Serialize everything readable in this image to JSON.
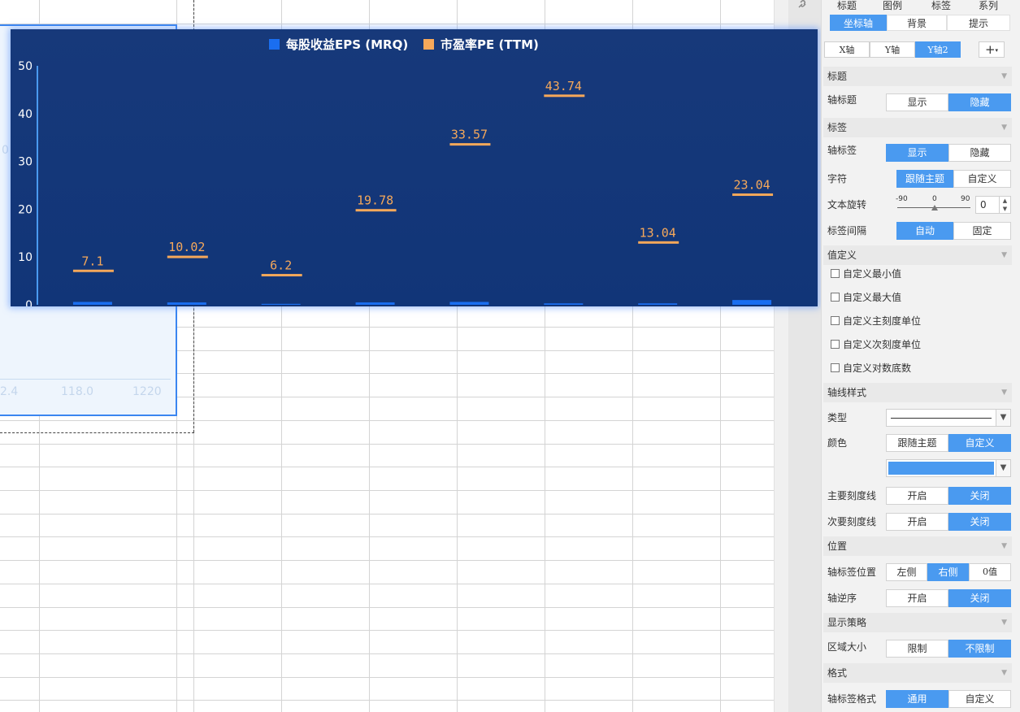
{
  "panel": {
    "top_tabs": [
      "标题",
      "图例",
      "标签",
      "系列"
    ],
    "sub_tabs": [
      "坐标轴",
      "背景",
      "提示"
    ],
    "axis_tabs": [
      "X轴",
      "Y轴",
      "Y轴2"
    ],
    "active_axis_tab": "Y轴2",
    "add_icon": "plus-icon",
    "sections": {
      "title": "标题",
      "label": "标签",
      "value_def": "值定义",
      "axis_style": "轴线样式",
      "position": "位置",
      "display": "显示策略",
      "format": "格式"
    },
    "axis_title": {
      "label": "轴标题",
      "options": [
        "显示",
        "隐藏"
      ],
      "selected": "隐藏"
    },
    "axis_label": {
      "label": "轴标签",
      "options": [
        "显示",
        "隐藏"
      ],
      "selected": "显示"
    },
    "font": {
      "label": "字符",
      "options": [
        "跟随主题",
        "自定义"
      ],
      "selected": "跟随主题"
    },
    "rotation": {
      "label": "文本旋转",
      "min": "-90",
      "mid": "0",
      "max": "90",
      "value": "0"
    },
    "interval": {
      "label": "标签间隔",
      "options": [
        "自动",
        "固定"
      ],
      "selected": "自动"
    },
    "checkboxes": [
      "自定义最小值",
      "自定义最大值",
      "自定义主刻度单位",
      "自定义次刻度单位",
      "自定义对数底数"
    ],
    "line_type": {
      "label": "类型"
    },
    "line_color": {
      "label": "颜色",
      "options": [
        "跟随主题",
        "自定义"
      ],
      "selected": "自定义",
      "swatch": "#4a9af0"
    },
    "major_tick": {
      "label": "主要刻度线",
      "options": [
        "开启",
        "关闭"
      ],
      "selected": "关闭"
    },
    "minor_tick": {
      "label": "次要刻度线",
      "options": [
        "开启",
        "关闭"
      ],
      "selected": "关闭"
    },
    "label_pos": {
      "label": "轴标签位置",
      "options": [
        "左侧",
        "右侧",
        "0值"
      ],
      "selected": "右侧"
    },
    "reverse": {
      "label": "轴逆序",
      "options": [
        "开启",
        "关闭"
      ],
      "selected": "关闭"
    },
    "area_size": {
      "label": "区域大小",
      "options": [
        "限制",
        "不限制"
      ],
      "selected": "不限制"
    },
    "label_format": {
      "label": "轴标签格式",
      "options": [
        "通用",
        "自定义"
      ],
      "selected": "通用"
    }
  },
  "under_chart_text": {
    "left": "0",
    "bottom_a": "2.4",
    "bottom_b": "118.0",
    "bottom_c": "1220"
  },
  "colors": {
    "chart_bg": "#123679",
    "eps": "#1a6ef0",
    "pe": "#f5a85a",
    "accent": "#4a9af0"
  },
  "chart_data": {
    "type": "bar",
    "legend": [
      {
        "name": "每股收益EPS (MRQ)",
        "color": "#1a6ef0"
      },
      {
        "name": "市盈率PE (TTM)",
        "color": "#f5a85a"
      }
    ],
    "legend_position": "top-center",
    "y_ticks": [
      "0",
      "10",
      "20",
      "30",
      "40",
      "50"
    ],
    "ylim": [
      0,
      50
    ],
    "series": [
      {
        "name": "每股收益EPS (MRQ)",
        "values": [
          0.6,
          0.5,
          0.2,
          0.5,
          0.6,
          0.3,
          0.3,
          1.0
        ]
      },
      {
        "name": "市盈率PE (TTM)",
        "values": [
          7.1,
          10.02,
          6.2,
          19.78,
          33.57,
          43.74,
          13.04,
          23.04
        ],
        "labels": [
          "7.1",
          "10.02",
          "6.2",
          "19.78",
          "33.57",
          "43.74",
          "13.04",
          "23.04"
        ]
      }
    ]
  }
}
